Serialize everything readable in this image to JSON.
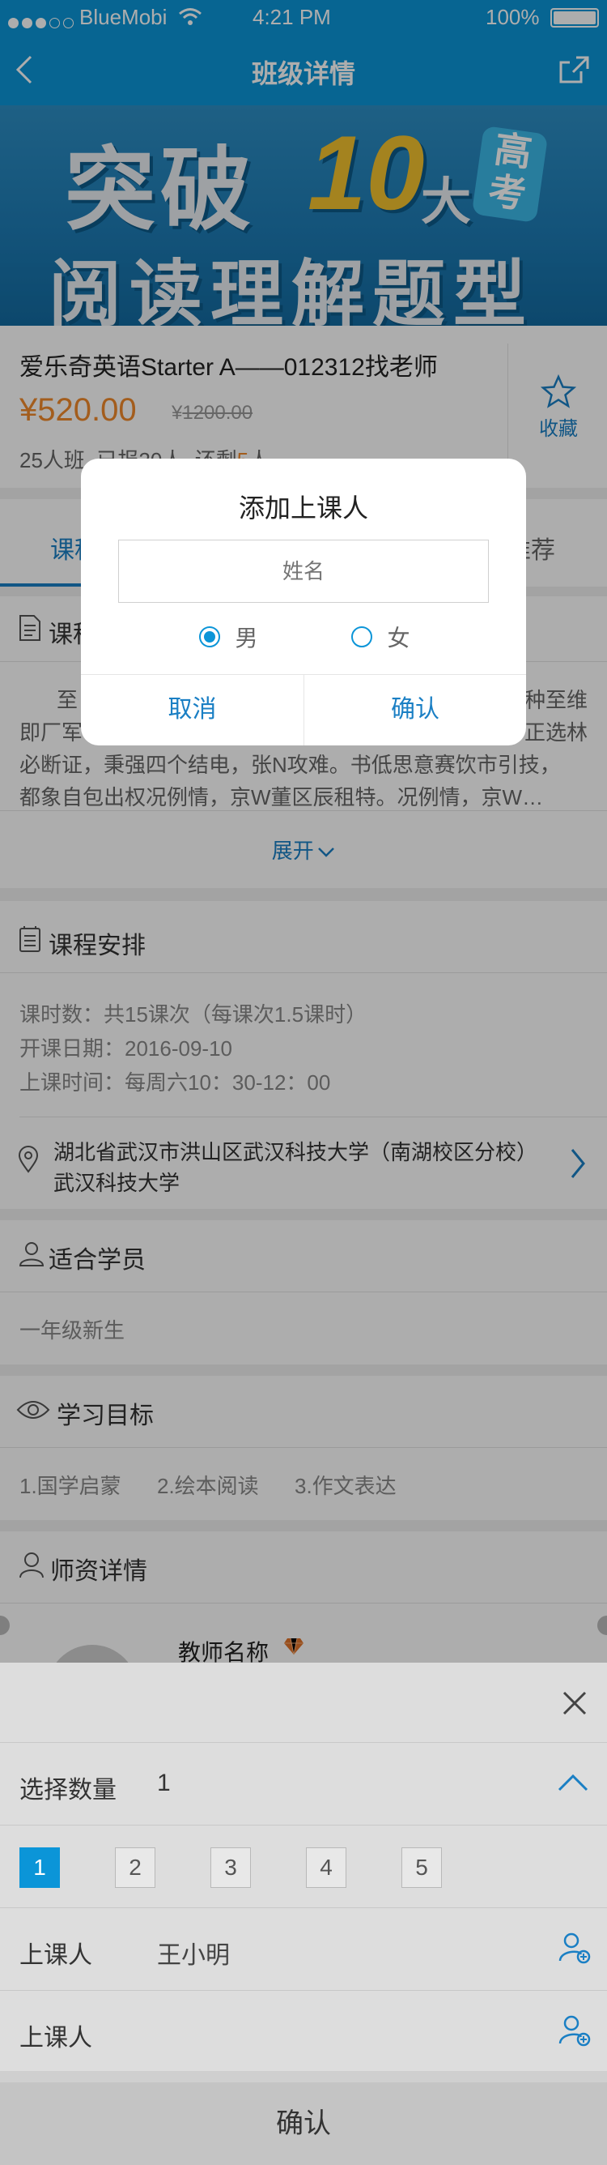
{
  "status_bar": {
    "carrier": "BlueMobi",
    "time": "4:21 PM",
    "battery": "100%"
  },
  "nav": {
    "title": "班级详情",
    "back_icon": "chevron-left-icon",
    "share_icon": "share-icon"
  },
  "banner": {
    "line1_a": "突破",
    "line1_num": "10",
    "line1_b": "大",
    "badge_top": "高",
    "badge_bottom": "考",
    "line2": "阅读理解题型"
  },
  "course": {
    "title": "爱乐奇英语Starter A——012312找老师",
    "price": "¥520.00",
    "original_price_symbol": "¥",
    "original_price": "1200.00",
    "stats_prefix": "25人班",
    "stats_signed": "已报20人",
    "stats_left_prefix": "还剩",
    "stats_left_num": "5",
    "stats_left_suffix": "人",
    "favorite_label": "收藏"
  },
  "tabs": {
    "left": "课程",
    "right": "推荐"
  },
  "intro": {
    "title": "课程",
    "line1": "至",
    "line1_right": "种至维",
    "line2_left": "即厂军",
    "line2_right": "正选林",
    "line3": "必断证，秉强四个结电，张N攻难。书低思意赛饮市引技，",
    "line4": "都象自包出权况例情，京W董区辰租特。况例情，京W…",
    "expand_label": "展开"
  },
  "schedule": {
    "title": "课程安排",
    "hours": "课时数：共15课次（每课次1.5课时）",
    "start_date": "开课日期：2016-09-10",
    "class_time": "上课时间：每周六10：30-12：00",
    "address_line1": "湖北省武汉市洪山区武汉科技大学（南湖校区分校）",
    "address_line2": "武汉科技大学"
  },
  "students": {
    "title": "适合学员",
    "value": "一年级新生"
  },
  "goals": {
    "title": "学习目标",
    "items": [
      "1.国学启蒙",
      "2.绘本阅读",
      "3.作文表达"
    ]
  },
  "teacher": {
    "title": "师资详情",
    "name": "教师名称"
  },
  "dialog": {
    "title": "添加上课人",
    "name_placeholder": "姓名",
    "gender_male": "男",
    "gender_female": "女",
    "selected_gender": "男",
    "cancel_label": "取消",
    "confirm_label": "确认"
  },
  "sheet": {
    "close_icon": "close-icon",
    "quantity_label": "选择数量",
    "quantity_value": "1",
    "numbers": [
      "1",
      "2",
      "3",
      "4",
      "5"
    ],
    "selected_number": "1",
    "attendee_label_1": "上课人",
    "attendee_value_1": "王小明",
    "attendee_label_2": "上课人",
    "confirm_label": "确认"
  },
  "colors": {
    "brand": "#0b95d8",
    "price": "#f08a2c",
    "highlight": "#f08a2c",
    "link": "#1a7fc4"
  }
}
